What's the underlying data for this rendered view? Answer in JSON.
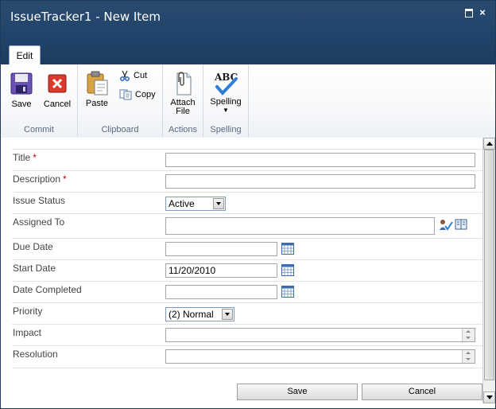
{
  "window": {
    "title": "IssueTracker1 - New Item",
    "maximize_symbol": "",
    "close_symbol": "×"
  },
  "ribbon": {
    "tab": "Edit",
    "groups": [
      {
        "label": "Commit"
      },
      {
        "label": "Clipboard"
      },
      {
        "label": "Actions"
      },
      {
        "label": "Spelling"
      }
    ],
    "buttons": {
      "save": "Save",
      "cancel": "Cancel",
      "paste": "Paste",
      "cut": "Cut",
      "copy": "Copy",
      "attach_line1": "Attach",
      "attach_line2": "File",
      "spelling": "Spelling",
      "spelling_icon_text": "ABC"
    }
  },
  "form": {
    "fields": [
      {
        "label": "Title",
        "required": "*",
        "value": ""
      },
      {
        "label": "Description",
        "required": "*",
        "value": ""
      },
      {
        "label": "Issue Status",
        "value": "Active"
      },
      {
        "label": "Assigned To",
        "value": ""
      },
      {
        "label": "Due Date",
        "value": ""
      },
      {
        "label": "Start Date",
        "value": "11/20/2010"
      },
      {
        "label": "Date Completed",
        "value": ""
      },
      {
        "label": "Priority",
        "value": "(2) Normal"
      },
      {
        "label": "Impact",
        "value": ""
      },
      {
        "label": "Resolution",
        "value": ""
      }
    ]
  },
  "footer": {
    "save": "Save",
    "cancel": "Cancel"
  },
  "colors": {
    "header_bg": "#21446a",
    "required": "#c00000"
  },
  "icons": [
    "save-icon",
    "cancel-icon",
    "paste-icon",
    "cut-icon",
    "copy-icon",
    "attach-file-icon",
    "spelling-icon",
    "calendar-icon",
    "check-names-icon",
    "address-book-icon"
  ]
}
